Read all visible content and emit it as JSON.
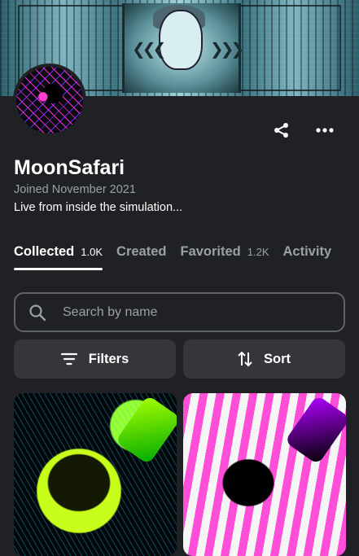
{
  "profile": {
    "name": "MoonSafari",
    "joined": "Joined November 2021",
    "bio": "Live from inside the simulation..."
  },
  "tabs": [
    {
      "label": "Collected",
      "count": "1.0K",
      "active": true
    },
    {
      "label": "Created",
      "count": "",
      "active": false
    },
    {
      "label": "Favorited",
      "count": "1.2K",
      "active": false
    },
    {
      "label": "Activity",
      "count": "",
      "active": false
    }
  ],
  "search": {
    "placeholder": "Search by name",
    "value": ""
  },
  "controls": {
    "filters_label": "Filters",
    "sort_label": "Sort"
  },
  "icons": {
    "share": "share-icon",
    "more": "more-horizontal-icon",
    "search": "search-icon",
    "filter": "filter-icon",
    "sort": "sort-icon"
  },
  "colors": {
    "background": "#202124",
    "surface": "#35363a",
    "muted_text": "#9aa0a6",
    "border": "#5f6368"
  }
}
